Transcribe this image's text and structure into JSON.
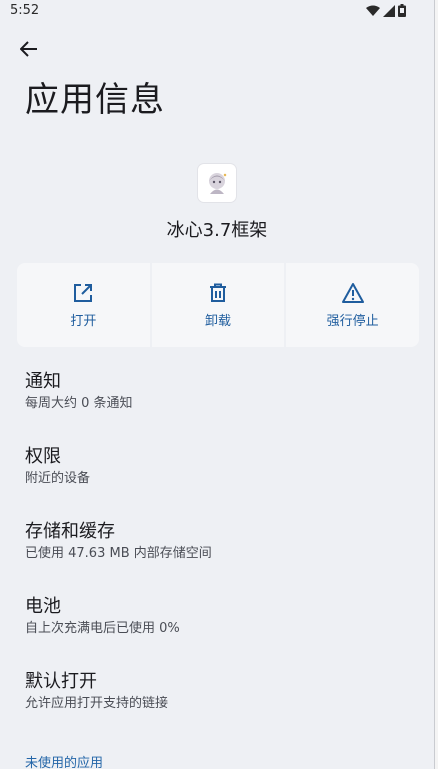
{
  "status_bar": {
    "time": "5:52"
  },
  "header": {
    "title": "应用信息"
  },
  "app": {
    "name": "冰心3.7框架"
  },
  "actions": [
    {
      "label": "打开",
      "icon": "open-external-icon"
    },
    {
      "label": "卸载",
      "icon": "trash-icon"
    },
    {
      "label": "强行停止",
      "icon": "warning-icon"
    }
  ],
  "items": [
    {
      "title": "通知",
      "subtitle": "每周大约 0 条通知"
    },
    {
      "title": "权限",
      "subtitle": "附近的设备"
    },
    {
      "title": "存储和缓存",
      "subtitle": "已使用 47.63 MB 内部存储空间"
    },
    {
      "title": "电池",
      "subtitle": "自上次充满电后已使用 0%"
    },
    {
      "title": "默认打开",
      "subtitle": "允许应用打开支持的链接"
    }
  ],
  "footer_link": "未使用的应用",
  "colors": {
    "accent": "#1f5d9e",
    "background": "#eef0f4",
    "button_bg": "#f6f7f9"
  }
}
